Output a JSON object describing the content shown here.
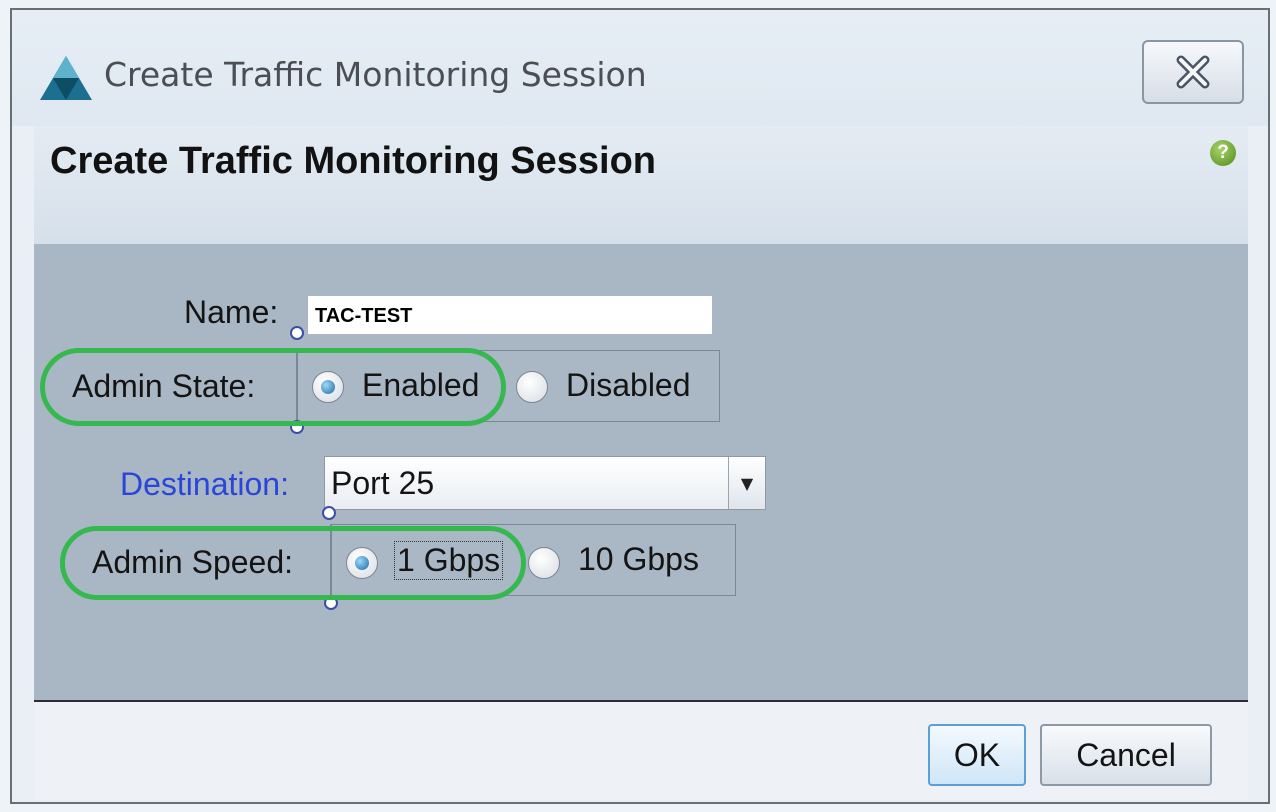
{
  "window": {
    "title": "Create Traffic Monitoring Session",
    "close_icon": "close-x-icon",
    "app_icon": "triangle-logo-icon"
  },
  "header": {
    "heading": "Create Traffic Monitoring Session",
    "help_icon": "help-question-icon",
    "help_glyph": "?"
  },
  "form": {
    "name": {
      "label": "Name:",
      "value": "TAC-TEST"
    },
    "admin_state": {
      "label": "Admin State:",
      "options": [
        {
          "label": "Enabled",
          "checked": true
        },
        {
          "label": "Disabled",
          "checked": false
        }
      ]
    },
    "destination": {
      "label": "Destination:",
      "value": "Port 25"
    },
    "admin_speed": {
      "label": "Admin Speed:",
      "options": [
        {
          "label": "1 Gbps",
          "checked": true
        },
        {
          "label": "10 Gbps",
          "checked": false
        }
      ]
    }
  },
  "footer": {
    "ok_label": "OK",
    "cancel_label": "Cancel"
  },
  "colors": {
    "highlight": "#35b94e",
    "link_label": "#2a46d8",
    "content_bg": "#a9b6c4"
  }
}
